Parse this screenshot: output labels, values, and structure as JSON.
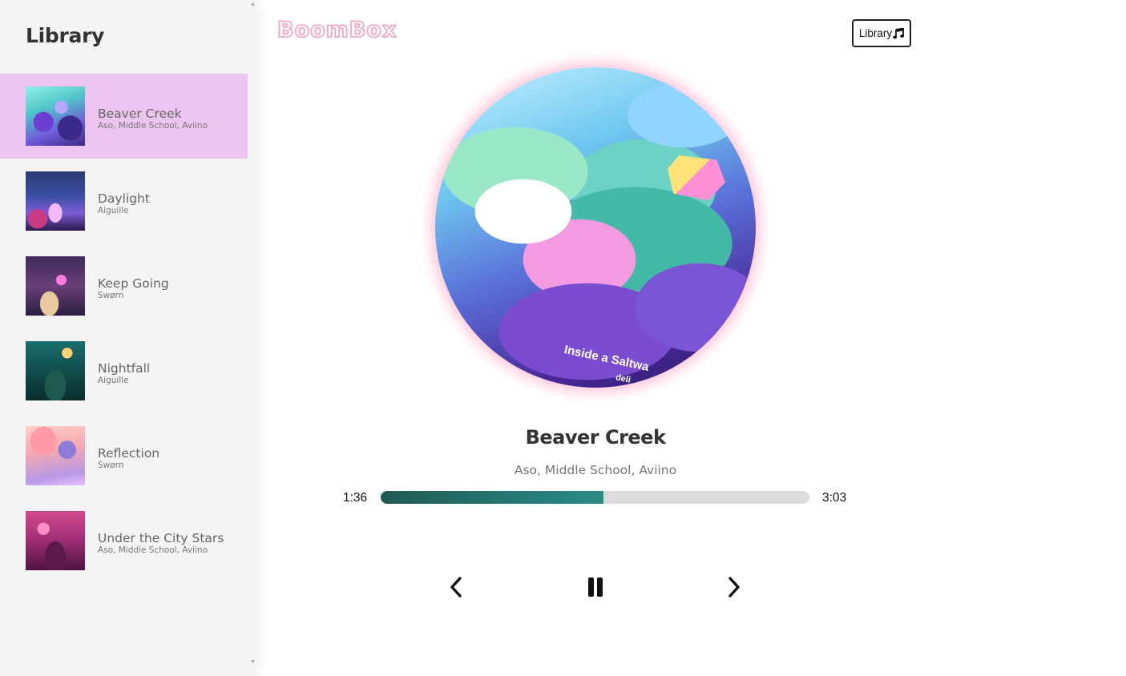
{
  "app": {
    "logo": "BoomBox",
    "accent": "#ecc4f0",
    "progress_color": "#2a8c86"
  },
  "sidebar": {
    "title": "Library",
    "songs": [
      {
        "name": "Beaver Creek",
        "artist": "Aso, Middle School, Aviino",
        "active": true
      },
      {
        "name": "Daylight",
        "artist": "Aiguille",
        "active": false
      },
      {
        "name": "Keep Going",
        "artist": "Swørn",
        "active": false
      },
      {
        "name": "Nightfall",
        "artist": "Aiguille",
        "active": false
      },
      {
        "name": "Reflection",
        "artist": "Swørn",
        "active": false
      },
      {
        "name": "Under the City Stars",
        "artist": "Aso, Middle School, Aviino",
        "active": false
      }
    ]
  },
  "header": {
    "library_button": "Library",
    "library_icon": "music-note-icon"
  },
  "player": {
    "title": "Beaver Creek",
    "artist": "Aso, Middle School, Aviino",
    "art_caption": "Inside a Saltwa",
    "art_caption_2": "deli",
    "current_time": "1:36",
    "total_time": "3:03",
    "progress": 0.52,
    "controls": {
      "prev_icon": "chevron-left-icon",
      "play_icon": "pause-icon",
      "next_icon": "chevron-right-icon"
    }
  }
}
